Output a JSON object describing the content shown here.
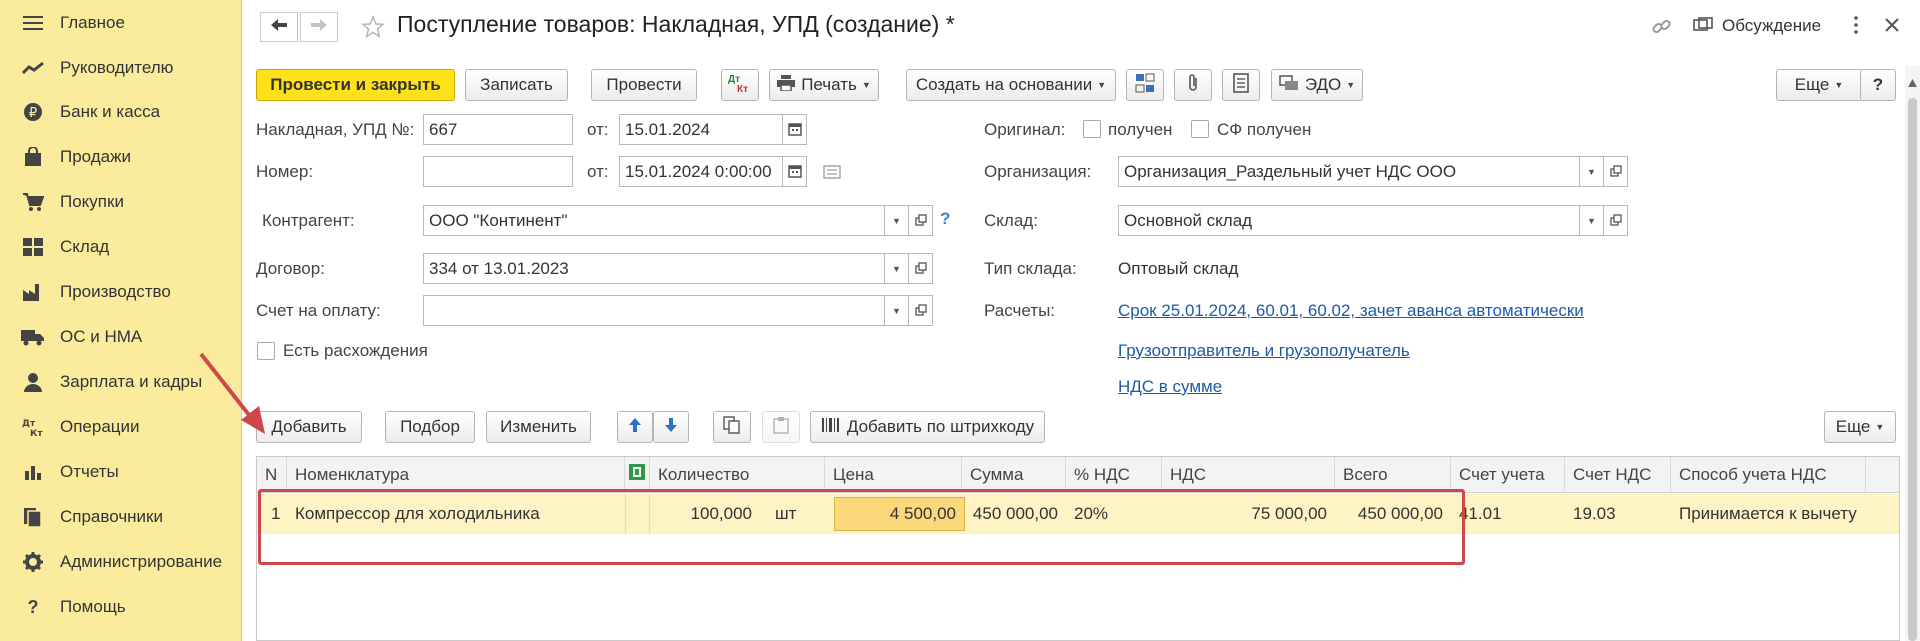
{
  "sidebar": {
    "items": [
      {
        "label": "Главное",
        "icon": "menu-icon"
      },
      {
        "label": "Руководителю",
        "icon": "trend-icon"
      },
      {
        "label": "Банк и касса",
        "icon": "ruble-coin-icon"
      },
      {
        "label": "Продажи",
        "icon": "shopping-bag-icon"
      },
      {
        "label": "Покупки",
        "icon": "cart-icon"
      },
      {
        "label": "Склад",
        "icon": "warehouse-grid-icon"
      },
      {
        "label": "Производство",
        "icon": "factory-icon"
      },
      {
        "label": "ОС и НМА",
        "icon": "truck-icon"
      },
      {
        "label": "Зарплата и кадры",
        "icon": "person-icon"
      },
      {
        "label": "Операции",
        "icon": "debit-credit-icon"
      },
      {
        "label": "Отчеты",
        "icon": "bar-chart-icon"
      },
      {
        "label": "Справочники",
        "icon": "books-icon"
      },
      {
        "label": "Администрирование",
        "icon": "gear-icon"
      },
      {
        "label": "Помощь",
        "icon": "question-icon"
      }
    ]
  },
  "header": {
    "title": "Поступление товаров: Накладная, УПД (создание) *",
    "discussion": "Обсуждение"
  },
  "toolbar": {
    "post_close": "Провести и закрыть",
    "save": "Записать",
    "post": "Провести",
    "dtkt_top": "Дт",
    "dtkt_bottom": "Кт",
    "print": "Печать",
    "create_based": "Создать на основании",
    "edo": "ЭДО",
    "more": "Еще",
    "help": "?"
  },
  "form": {
    "invoice_label": "Накладная, УПД №:",
    "invoice_number": "667",
    "from_label": "от:",
    "invoice_date": "15.01.2024",
    "number_label": "Номер:",
    "number_value": "",
    "number_date": "15.01.2024  0:00:00",
    "counterparty_label": "Контрагент:",
    "counterparty": "ООО \"Континент\"",
    "contract_label": "Договор:",
    "contract": "334 от 13.01.2023",
    "payment_label": "Счет на оплату:",
    "payment": "",
    "discrepancy_label": "Есть расхождения",
    "original_label": "Оригинал:",
    "received_label": "получен",
    "sf_received_label": "СФ получен",
    "org_label": "Организация:",
    "org": "Организация_Раздельный учет НДС ООО",
    "warehouse_label": "Склад:",
    "warehouse": "Основной склад",
    "wh_type_label": "Тип склада:",
    "wh_type": "Оптовый склад",
    "settlements_label": "Расчеты:",
    "settlements_link": "Срок 25.01.2024, 60.01, 60.02, зачет аванса автоматически",
    "shipper_link": "Грузоотправитель и грузополучатель",
    "vat_link": "НДС в сумме",
    "help_mark": "?"
  },
  "table_toolbar": {
    "add": "Добавить",
    "pick": "Подбор",
    "edit": "Изменить",
    "barcode": "Добавить по штрихкоду",
    "more": "Еще"
  },
  "table": {
    "headers": [
      "N",
      "Номенклатура",
      "Количество",
      "Цена",
      "Сумма",
      "% НДС",
      "НДС",
      "Всего",
      "Счет учета",
      "Счет НДС",
      "Способ учета НДС"
    ],
    "rows": [
      {
        "n": "1",
        "item": "Компрессор для холодильника",
        "qty": "100,000",
        "unit": "шт",
        "price": "4 500,00",
        "sum": "450 000,00",
        "vat_rate": "20%",
        "vat": "75 000,00",
        "total": "450 000,00",
        "account": "41.01",
        "vat_account": "19.03",
        "vat_method": "Принимается к вычету"
      }
    ]
  },
  "colors": {
    "sidebar_bg": "#fbec9d",
    "primary_button": "#ffe11a",
    "row_highlight": "#fdf3c5",
    "annotation_red": "#d0474b",
    "link": "#1e5aa8"
  }
}
